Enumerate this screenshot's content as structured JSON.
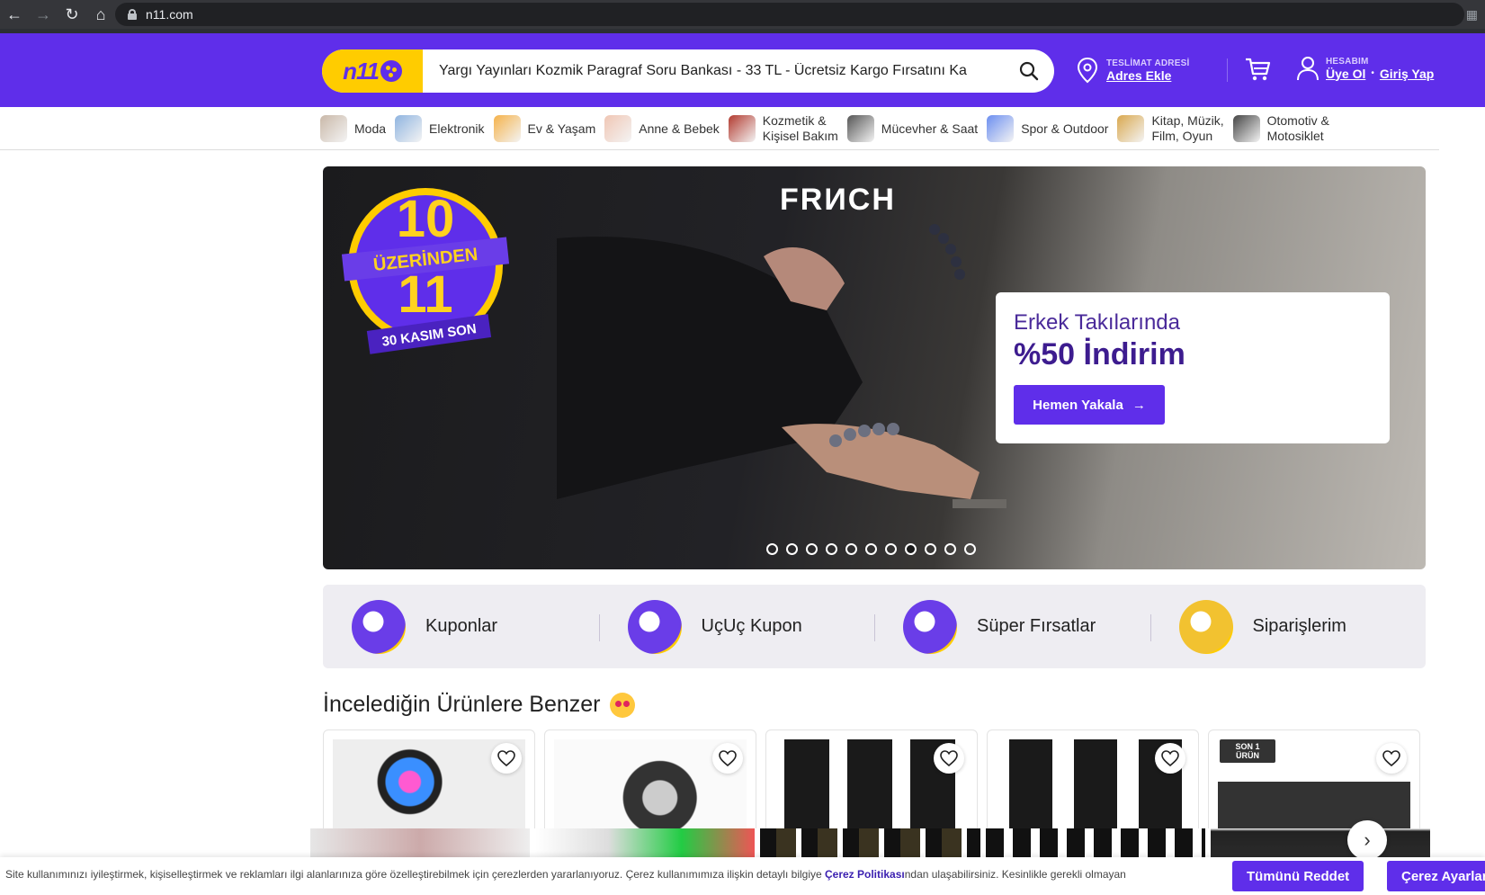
{
  "browser": {
    "url": "n11.com"
  },
  "header": {
    "logo_text": "n11",
    "search_value": "Yargı Yayınları Kozmik Paragraf Soru Bankası - 33 TL - Ücretsiz Kargo Fırsatını Ka",
    "delivery_caption": "TESLİMAT ADRESİ",
    "delivery_link": "Adres Ekle",
    "account_caption": "HESABIM",
    "signup_link": "Üye Ol",
    "login_link": "Giriş Yap"
  },
  "categories": [
    {
      "label": "Moda",
      "color": "#c9b8a8"
    },
    {
      "label": "Elektronik",
      "color": "#8fb4e0"
    },
    {
      "label": "Ev & Yaşam",
      "color": "#f5b24a"
    },
    {
      "label": "Anne & Bebek",
      "color": "#f0c6b4"
    },
    {
      "label": "Kozmetik &\nKişisel Bakım",
      "color": "#b23a2f"
    },
    {
      "label": "Mücevher & Saat",
      "color": "#555555"
    },
    {
      "label": "Spor & Outdoor",
      "color": "#6b8ef0"
    },
    {
      "label": "Kitap, Müzik,\nFilm, Oyun",
      "color": "#d9a84e"
    },
    {
      "label": "Otomotiv &\nMotosiklet",
      "color": "#444444"
    }
  ],
  "hero": {
    "badge_top": "10",
    "badge_mid": "ÜZERİNDEN",
    "badge_num": "11",
    "badge_bottom": "30 KASIM SON",
    "brand": "FRИCH",
    "line1": "Erkek Takılarında",
    "line2": "%50 İndirim",
    "cta": "Hemen Yakala",
    "slide_count": 11,
    "active_slide": 8
  },
  "shortcuts": [
    {
      "label": "Kuponlar",
      "color": "#6a3de8"
    },
    {
      "label": "UçUç Kupon",
      "color": "#6a3de8"
    },
    {
      "label": "Süper Fırsatlar",
      "color": "#6a3de8"
    },
    {
      "label": "Siparişlerim",
      "color": "#f2c230"
    }
  ],
  "section": {
    "title": "İncelediğin Ürünlere Benzer"
  },
  "products": [
    {
      "badge": ""
    },
    {
      "badge": ""
    },
    {
      "badge": ""
    },
    {
      "badge": ""
    },
    {
      "badge": "SON 1 ÜRÜN"
    }
  ],
  "cookie": {
    "text_before": "Site kullanımınızı iyileştirmek, kişiselleştirmek ve reklamları ilgi alanlarınıza göre özelleştirebilmek için çerezlerden yararlanıyoruz. Çerez kullanımımıza ilişkin detaylı bilgiye ",
    "policy_link": "Çerez Politikası",
    "text_after": "ndan ulaşabilirsiniz. Kesinlikle gerekli olmayan",
    "reject_all": "Tümünü Reddet",
    "settings": "Çerez Ayarları"
  }
}
